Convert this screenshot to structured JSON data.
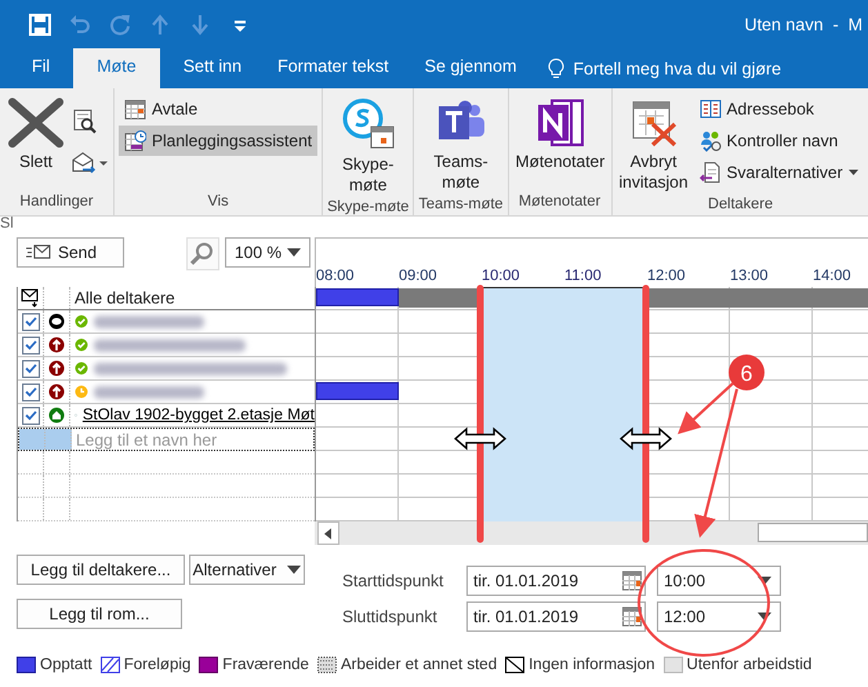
{
  "window": {
    "title": "Uten navn  -  M"
  },
  "quick_access": [
    {
      "kind": "save",
      "disabled": false
    },
    {
      "kind": "undo",
      "disabled": true
    },
    {
      "kind": "redo",
      "disabled": true
    },
    {
      "kind": "up",
      "disabled": true
    },
    {
      "kind": "down",
      "disabled": true
    },
    {
      "kind": "customize",
      "disabled": false
    }
  ],
  "tabs": [
    {
      "label": "Fil",
      "selected": false
    },
    {
      "label": "Møte",
      "selected": true
    },
    {
      "label": "Sett inn",
      "selected": false
    },
    {
      "label": "Formater tekst",
      "selected": false
    },
    {
      "label": "Se gjennom",
      "selected": false
    }
  ],
  "tell_me": "Fortell meg hva du vil gjøre",
  "ribbon_groups": [
    {
      "label": "Handlinger",
      "items": [
        {
          "kind": "large",
          "label": "Slett"
        },
        {
          "kind": "icon_stack"
        }
      ]
    },
    {
      "label": "Vis",
      "items": [
        {
          "kind": "small",
          "label": "Avtale",
          "selected": false
        },
        {
          "kind": "small",
          "label": "Planleggingsassistent",
          "selected": true
        }
      ]
    },
    {
      "label": "Skype-møte",
      "items": [
        {
          "kind": "large",
          "label": "Skype-møte"
        }
      ]
    },
    {
      "label": "Teams-møte",
      "items": [
        {
          "kind": "large",
          "label": "Teams-møte"
        }
      ]
    },
    {
      "label": "Møtenotater",
      "items": [
        {
          "kind": "large",
          "label": "Møtenotater"
        }
      ]
    },
    {
      "label": "Deltakere",
      "items": [
        {
          "kind": "large",
          "label": "Avbryt invitasjon"
        },
        {
          "kind": "small",
          "label": "Adressebok",
          "selected": false
        },
        {
          "kind": "small",
          "label": "Kontroller navn",
          "selected": false
        },
        {
          "kind": "small",
          "label": "Svaralternativer",
          "selected": false,
          "dropdown": true
        }
      ]
    }
  ],
  "cut_label": "Sl",
  "send_button": "Send",
  "zoom": {
    "value": "100 %"
  },
  "attendee_header": "Alle deltakere",
  "hours": [
    {
      "label": "08:00",
      "selected": false
    },
    {
      "label": "09:00",
      "selected": false
    },
    {
      "label": "10:00",
      "selected": true
    },
    {
      "label": "11:00",
      "selected": true
    },
    {
      "label": "12:00",
      "selected": false
    },
    {
      "label": "13:00",
      "selected": false
    },
    {
      "label": "14:00",
      "selected": false
    }
  ],
  "all_attendees_slots": [
    {
      "kind": "busy"
    },
    {
      "kind": "no_info"
    },
    {
      "kind": "free"
    },
    {
      "kind": "free"
    },
    {
      "kind": "no_info"
    },
    {
      "kind": "no_info"
    },
    {
      "kind": "no_info"
    }
  ],
  "attendees": [
    {
      "checked": true,
      "kind": "organizer",
      "accepted": true,
      "awaiting": false,
      "blurred": true
    },
    {
      "checked": true,
      "kind": "required",
      "accepted": true,
      "awaiting": false,
      "blurred": true
    },
    {
      "checked": true,
      "kind": "required",
      "accepted": true,
      "awaiting": false,
      "blurred": true
    },
    {
      "checked": true,
      "kind": "required",
      "accepted": false,
      "awaiting": true,
      "blurred": true,
      "slots": [
        {
          "kind": "busy"
        },
        {
          "kind": "free"
        },
        {
          "kind": "free"
        },
        {
          "kind": "free"
        },
        {
          "kind": "free"
        },
        {
          "kind": "free"
        },
        {
          "kind": "free"
        }
      ]
    },
    {
      "checked": true,
      "kind": "room",
      "accepted": false,
      "awaiting": false,
      "blurred": false,
      "name": "StOlav 1902-bygget 2.etasje Møt"
    }
  ],
  "add_name": {
    "placeholder": "Legg til et navn her"
  },
  "buttons": {
    "add_attendees": "Legg til deltakere...",
    "options": "Alternativer",
    "add_room": "Legg til rom..."
  },
  "start": {
    "label": "Starttidspunkt",
    "date": "tir. 01.01.2019",
    "time": "10:00"
  },
  "end": {
    "label": "Sluttidspunkt",
    "date": "tir. 01.01.2019",
    "time": "12:00"
  },
  "legend": [
    {
      "kind": "busy",
      "label": "Opptatt"
    },
    {
      "kind": "tentative",
      "label": "Foreløpig"
    },
    {
      "kind": "away",
      "label": "Fraværende"
    },
    {
      "kind": "elsewhere",
      "label": "Arbeider et annet sted"
    },
    {
      "kind": "no_info",
      "label": "Ingen informasjon"
    },
    {
      "kind": "outside",
      "label": "Utenfor arbeidstid"
    }
  ],
  "callout": {
    "label": "6"
  }
}
